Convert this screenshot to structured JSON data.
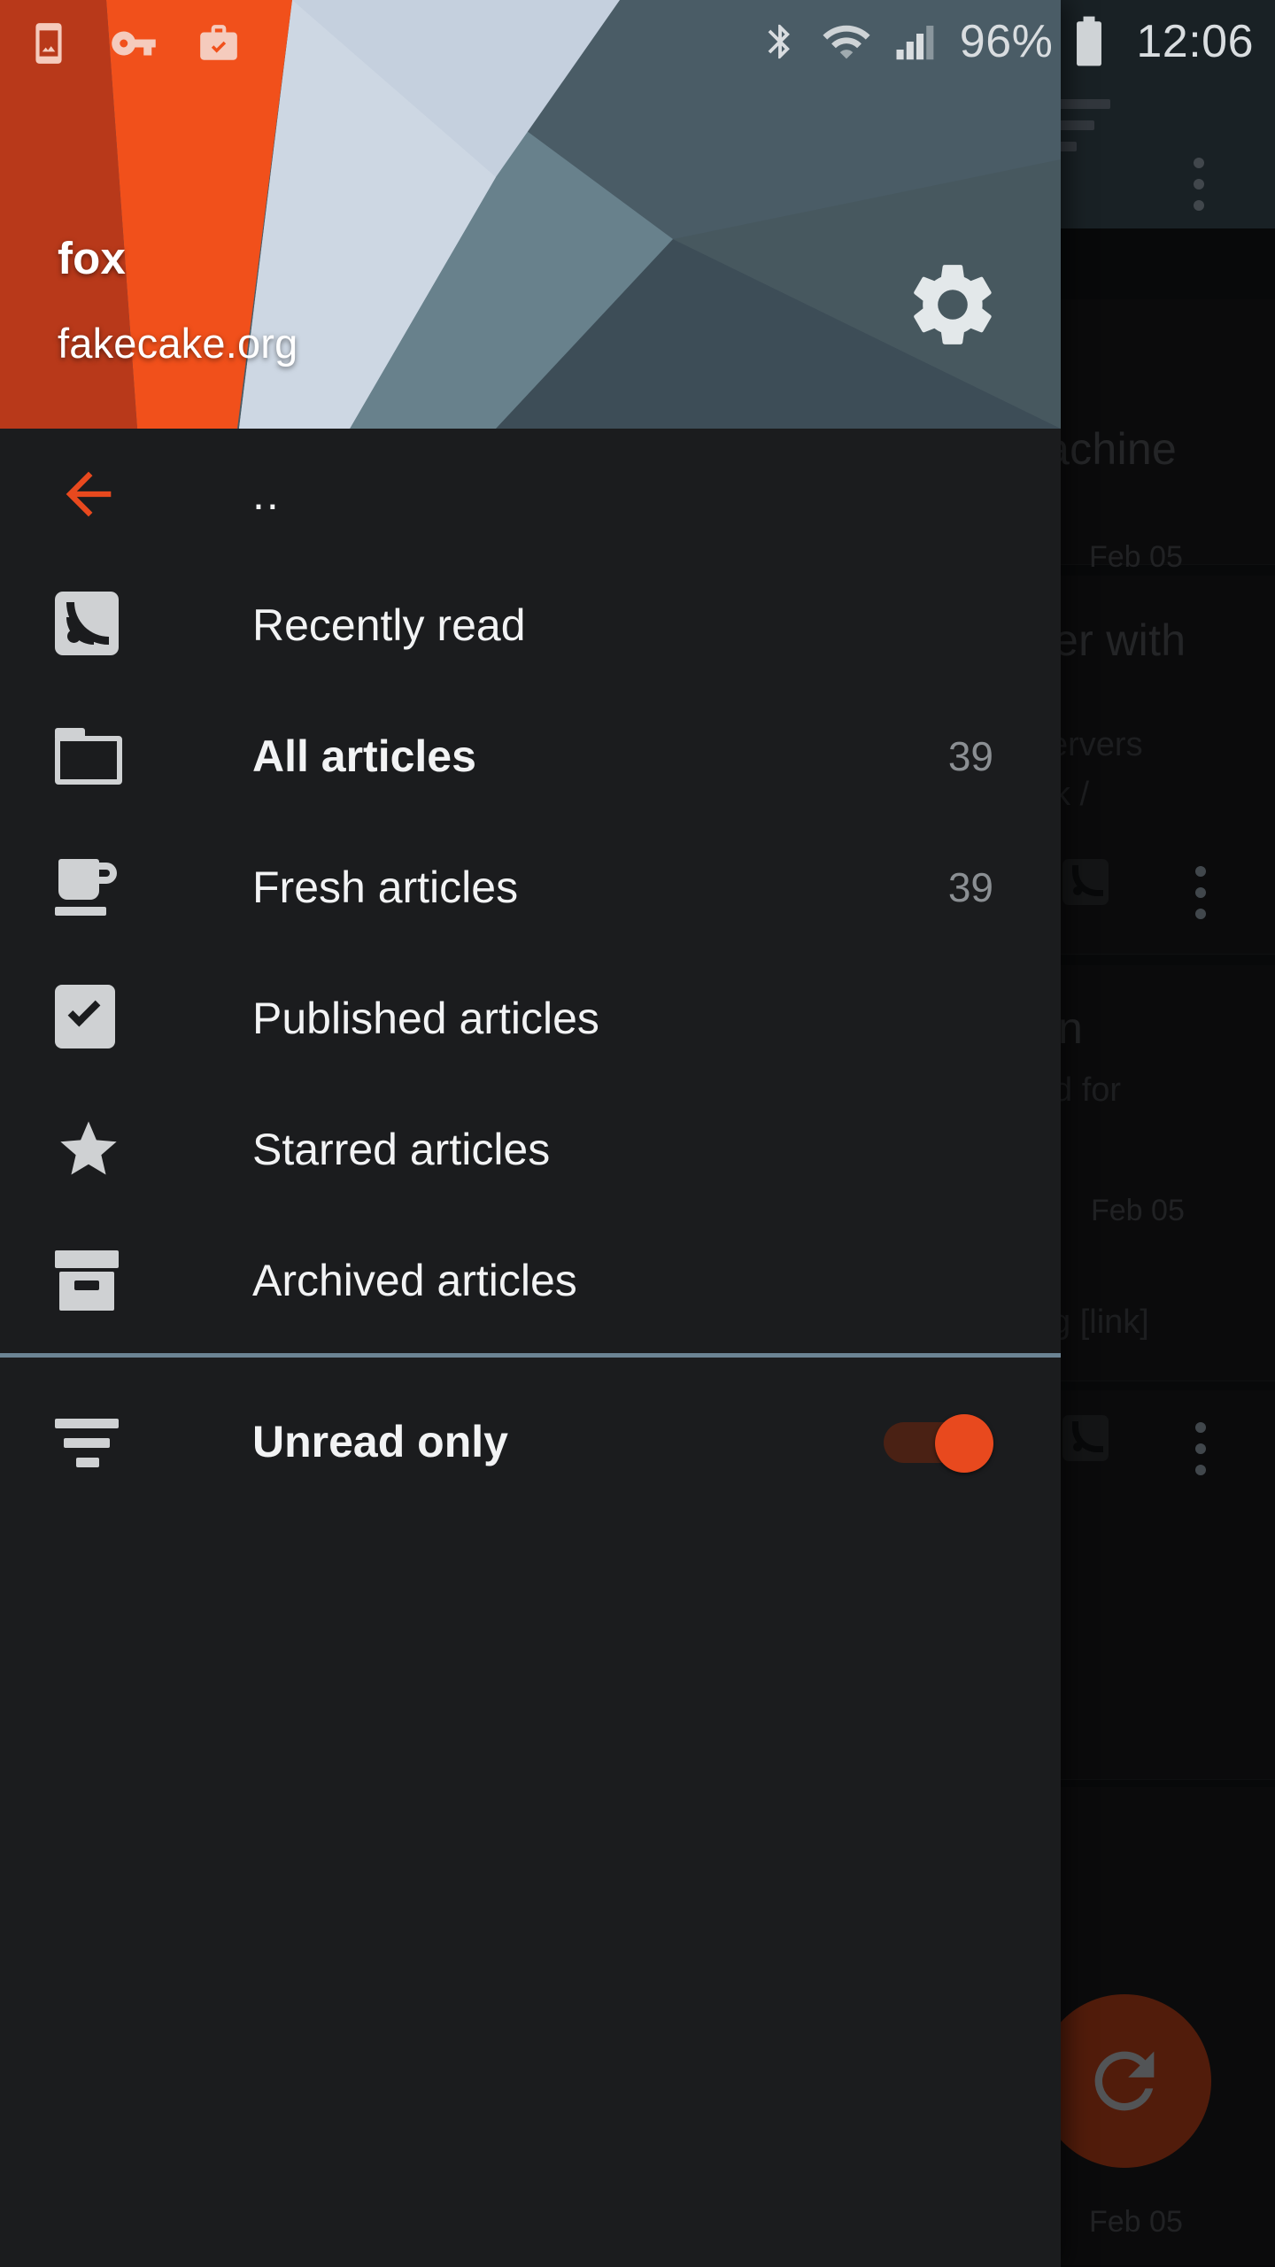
{
  "statusbar": {
    "left_icons": [
      "screenshot-icon",
      "vpn-key-icon",
      "work-profile-icon"
    ],
    "bluetooth_icon": "bluetooth-icon",
    "wifi_icon": "wifi-icon",
    "signal_icon": "cellular-signal-icon",
    "battery_percent": "96%",
    "battery_icon": "battery-icon",
    "clock": "12:06"
  },
  "drawer": {
    "account_name": "fox",
    "account_host": "fakecake.org",
    "settings_icon": "gear-icon",
    "up_row": {
      "back_icon": "back-arrow-icon",
      "label": ".."
    },
    "items": [
      {
        "icon": "rss-icon",
        "label": "Recently read",
        "count": "",
        "bold": false
      },
      {
        "icon": "folder-icon",
        "label": "All articles",
        "count": "39",
        "bold": true
      },
      {
        "icon": "coffee-cup-icon",
        "label": "Fresh articles",
        "count": "39",
        "bold": false
      },
      {
        "icon": "checkbox-icon",
        "label": "Published articles",
        "count": "",
        "bold": false
      },
      {
        "icon": "star-icon",
        "label": "Starred articles",
        "count": "",
        "bold": false
      },
      {
        "icon": "archive-icon",
        "label": "Archived articles",
        "count": "",
        "bold": false
      }
    ],
    "unread_only": {
      "icon": "filter-icon",
      "label": "Unread only",
      "toggle_state": "on"
    }
  },
  "background": {
    "appbar": {
      "sort_icon": "sort-icon",
      "overflow_icon": "overflow-menu-icon"
    },
    "cards": [
      {
        "title": "achine",
        "sub": "",
        "date": "Feb 05",
        "rss": false,
        "overflow": false
      },
      {
        "title": "er with",
        "sub": "ervers",
        "sub2": "k /",
        "date": "",
        "rss": true,
        "overflow": true
      },
      {
        "title": "n",
        "sub": "d for",
        "date": "Feb 05",
        "link": "g [link]",
        "rss": true,
        "overflow": true
      },
      {
        "title": "",
        "sub": "",
        "date": "Feb 05",
        "rss": false,
        "overflow": false
      }
    ],
    "fab_icon": "refresh-icon"
  },
  "colors": {
    "accent_orange": "#e8491e",
    "accent_orange_dark": "#b8391a",
    "header_slate": "#4a5c66",
    "drawer_bg": "#1b1c1e",
    "divider": "#6c8494"
  }
}
